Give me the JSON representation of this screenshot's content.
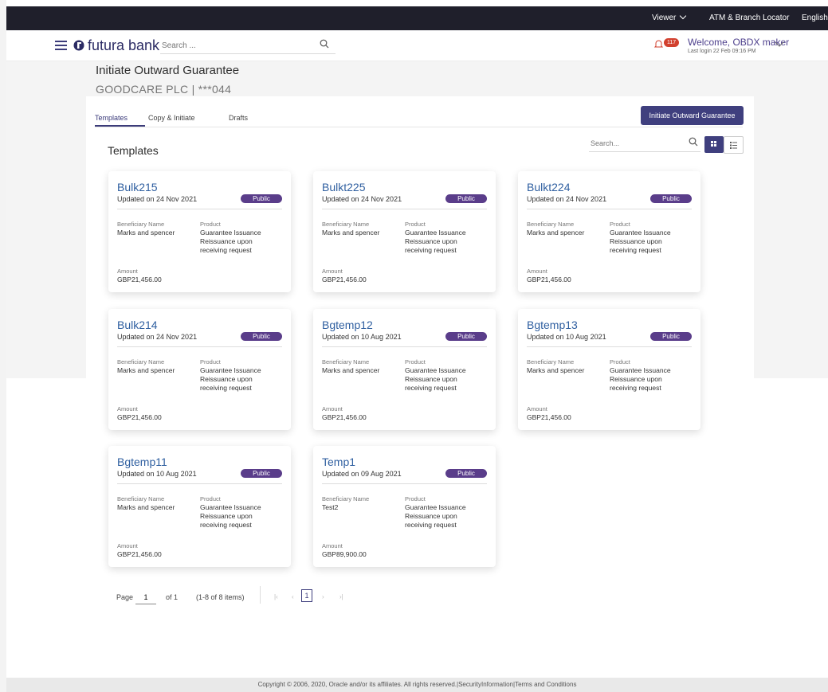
{
  "topbar": {
    "viewer": "Viewer",
    "atm": "ATM & Branch Locator",
    "language": "English"
  },
  "header": {
    "brand": "futura bank",
    "search_placeholder": "Search ...",
    "notification_count": "117",
    "welcome": "Welcome, OBDX maker",
    "last_login": "Last login 22 Feb 09:16 PM"
  },
  "page": {
    "title": "Initiate Outward Guarantee",
    "party": "GOODCARE PLC | ***044"
  },
  "tabs": [
    "Templates",
    "Copy & Initiate",
    "Drafts"
  ],
  "initiate_button": "Initiate Outward Guarantee",
  "templates": {
    "title": "Templates",
    "search_placeholder": "Search...",
    "labels": {
      "beneficiary": "Beneficiary Name",
      "product": "Product",
      "amount": "Amount"
    },
    "cards": [
      {
        "name": "Bulk215",
        "updated": "Updated on 24 Nov 2021",
        "badge": "Public",
        "beneficiary": "Marks and spencer",
        "product": "Guarantee Issuance Reissuance upon receiving request",
        "amount": "GBP21,456.00"
      },
      {
        "name": "Bulkt225",
        "updated": "Updated on 24 Nov 2021",
        "badge": "Public",
        "beneficiary": "Marks and spencer",
        "product": "Guarantee Issuance Reissuance upon receiving request",
        "amount": "GBP21,456.00"
      },
      {
        "name": "Bulkt224",
        "updated": "Updated on 24 Nov 2021",
        "badge": "Public",
        "beneficiary": "Marks and spencer",
        "product": "Guarantee Issuance Reissuance upon receiving request",
        "amount": "GBP21,456.00"
      },
      {
        "name": "Bulk214",
        "updated": "Updated on 24 Nov 2021",
        "badge": "Public",
        "beneficiary": "Marks and spencer",
        "product": "Guarantee Issuance Reissuance upon receiving request",
        "amount": "GBP21,456.00"
      },
      {
        "name": "Bgtemp12",
        "updated": "Updated on 10 Aug 2021",
        "badge": "Public",
        "beneficiary": "Marks and spencer",
        "product": "Guarantee Issuance Reissuance upon receiving request",
        "amount": "GBP21,456.00"
      },
      {
        "name": "Bgtemp13",
        "updated": "Updated on 10 Aug 2021",
        "badge": "Public",
        "beneficiary": "Marks and spencer",
        "product": "Guarantee Issuance Reissuance upon receiving request",
        "amount": "GBP21,456.00"
      },
      {
        "name": "Bgtemp11",
        "updated": "Updated on 10 Aug 2021",
        "badge": "Public",
        "beneficiary": "Marks and spencer",
        "product": "Guarantee Issuance Reissuance upon receiving request",
        "amount": "GBP21,456.00"
      },
      {
        "name": "Temp1",
        "updated": "Updated on 09 Aug 2021",
        "badge": "Public",
        "beneficiary": "Test2",
        "product": "Guarantee Issuance Reissuance upon receiving request",
        "amount": "GBP89,900.00"
      }
    ]
  },
  "pagination": {
    "page_label": "Page",
    "page_value": "1",
    "of": "of 1",
    "items": "(1-8 of 8 items)",
    "current": "1"
  },
  "footer": "Copyright © 2006, 2020, Oracle and/or its affiliates. All rights reserved.|SecurityInformation|Terms and Conditions",
  "colors": {
    "primary": "#3f3f7e",
    "badge": "#5a3d8a",
    "link": "#2f5fa0",
    "topbar": "#1f1f2b"
  }
}
